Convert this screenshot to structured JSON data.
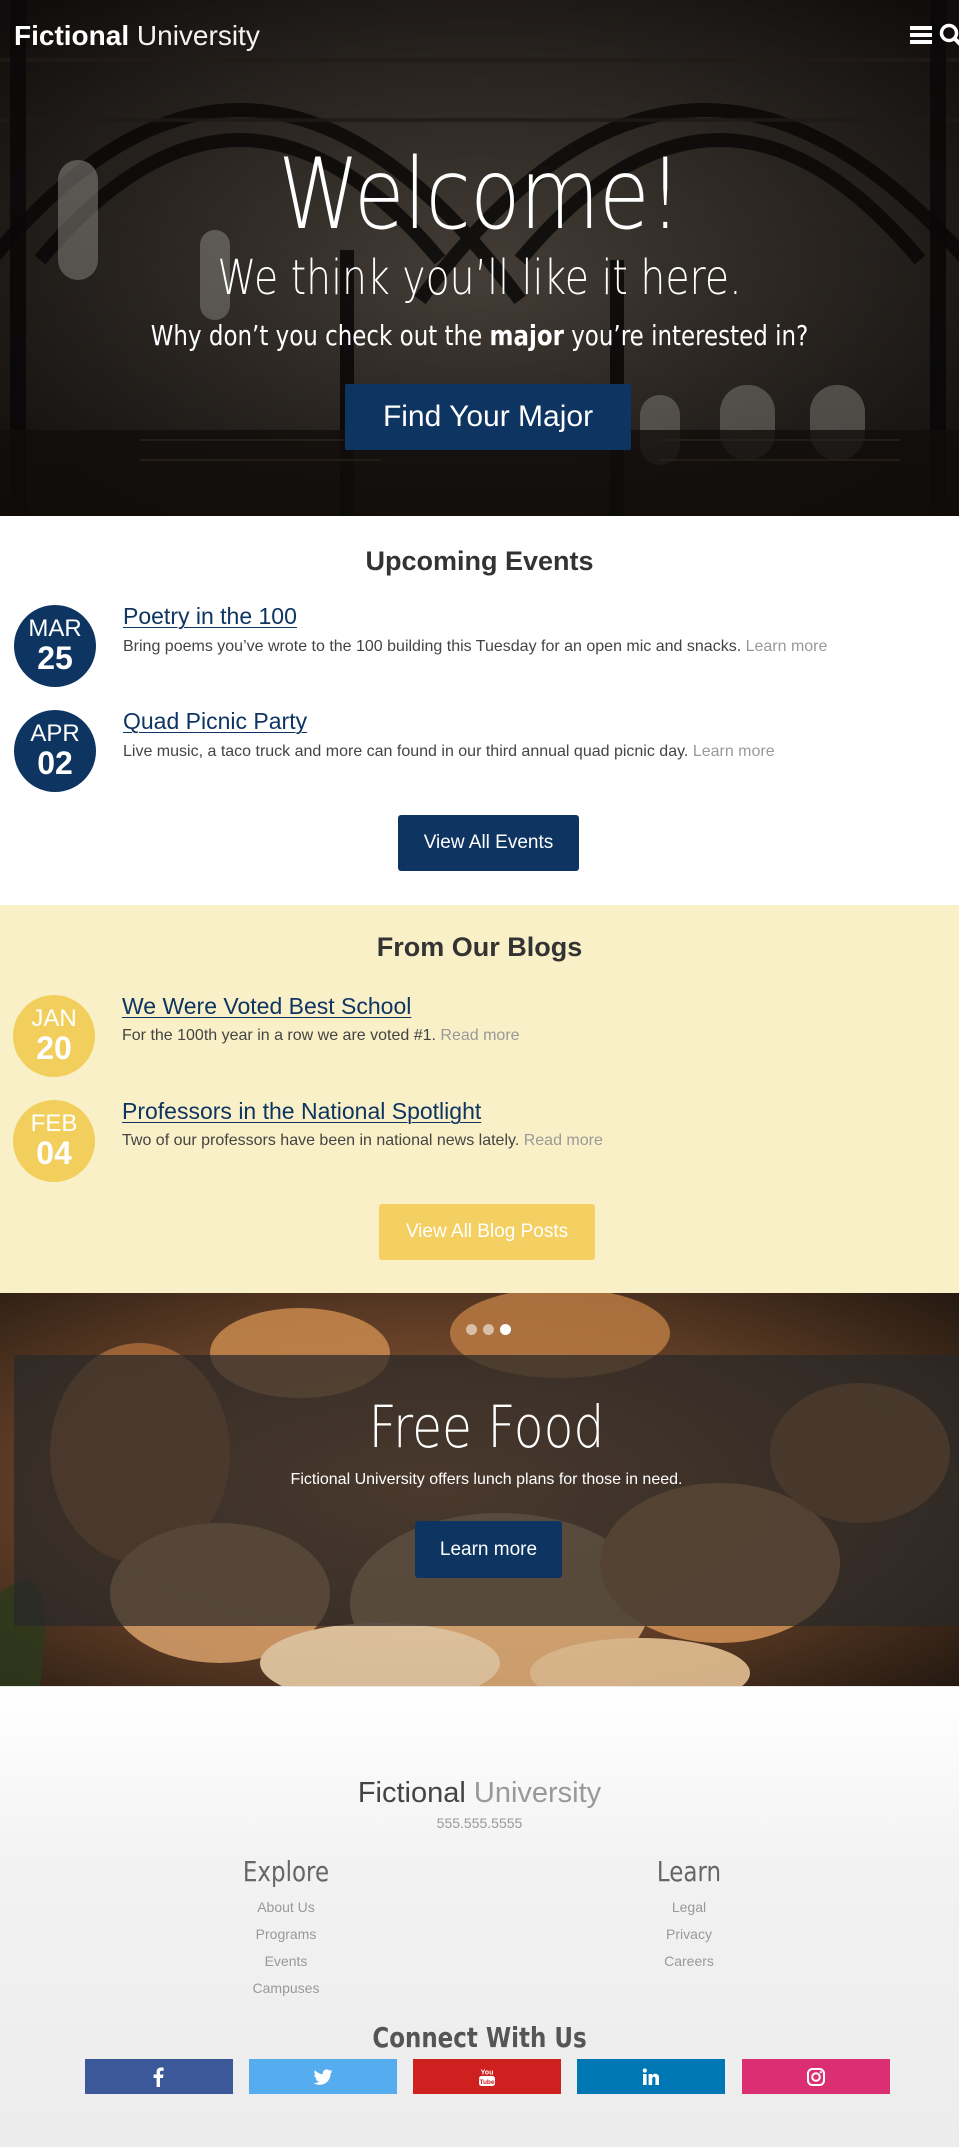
{
  "header": {
    "logo_strong": "Fictional",
    "logo_light": "University",
    "menu_icon": "hamburger-menu-icon",
    "search_icon": "search-icon"
  },
  "hero": {
    "title": "Welcome!",
    "subtitle": "We think you’ll like it here.",
    "text_before": "Why don’t you check out the ",
    "text_strong": "major",
    "text_after": " you’re interested in?",
    "button": "Find Your Major"
  },
  "events": {
    "title": "Upcoming Events",
    "items": [
      {
        "month": "MAR",
        "day": "25",
        "title": "Poetry in the 100",
        "text": "Bring poems you’ve wrote to the 100 building this Tuesday for an open mic and snacks. ",
        "more": "Learn more"
      },
      {
        "month": "APR",
        "day": "02",
        "title": "Quad Picnic Party",
        "text": "Live music, a taco truck and more can found in our third annual quad picnic day. ",
        "more": "Learn more"
      }
    ],
    "button": "View All Events"
  },
  "blogs": {
    "title": "From Our Blogs",
    "items": [
      {
        "month": "JAN",
        "day": "20",
        "title": "We Were Voted Best School",
        "text": "For the 100th year in a row we are voted #1. ",
        "more": "Read more"
      },
      {
        "month": "FEB",
        "day": "04",
        "title": "Professors in the National Spotlight",
        "text": "Two of our professors have been in national news lately. ",
        "more": "Read more"
      }
    ],
    "button": "View All Blog Posts"
  },
  "slider": {
    "slide_count": 3,
    "active_slide": 3,
    "title": "Free Food",
    "text": "Fictional University offers lunch plans for those in need.",
    "button": "Learn more"
  },
  "footer": {
    "logo_strong": "Fictional",
    "logo_light": "University",
    "phone": "555.555.5555",
    "explore": {
      "title": "Explore",
      "links": [
        "About Us",
        "Programs",
        "Events",
        "Campuses"
      ]
    },
    "learn": {
      "title": "Learn",
      "links": [
        "Legal",
        "Privacy",
        "Careers"
      ]
    },
    "connect_title": "Connect With Us",
    "social": [
      {
        "icon": "facebook-icon",
        "color": "#3b5998"
      },
      {
        "icon": "twitter-icon",
        "color": "#55acee"
      },
      {
        "icon": "youtube-icon",
        "color": "#cd201f"
      },
      {
        "icon": "linkedin-icon",
        "color": "#0077b5"
      },
      {
        "icon": "instagram-icon",
        "color": "#dc2f73"
      }
    ]
  },
  "colors": {
    "brand_navy": "#0e3462",
    "brand_yellow": "#f2cf5c",
    "blog_background": "#f9f0c7"
  }
}
